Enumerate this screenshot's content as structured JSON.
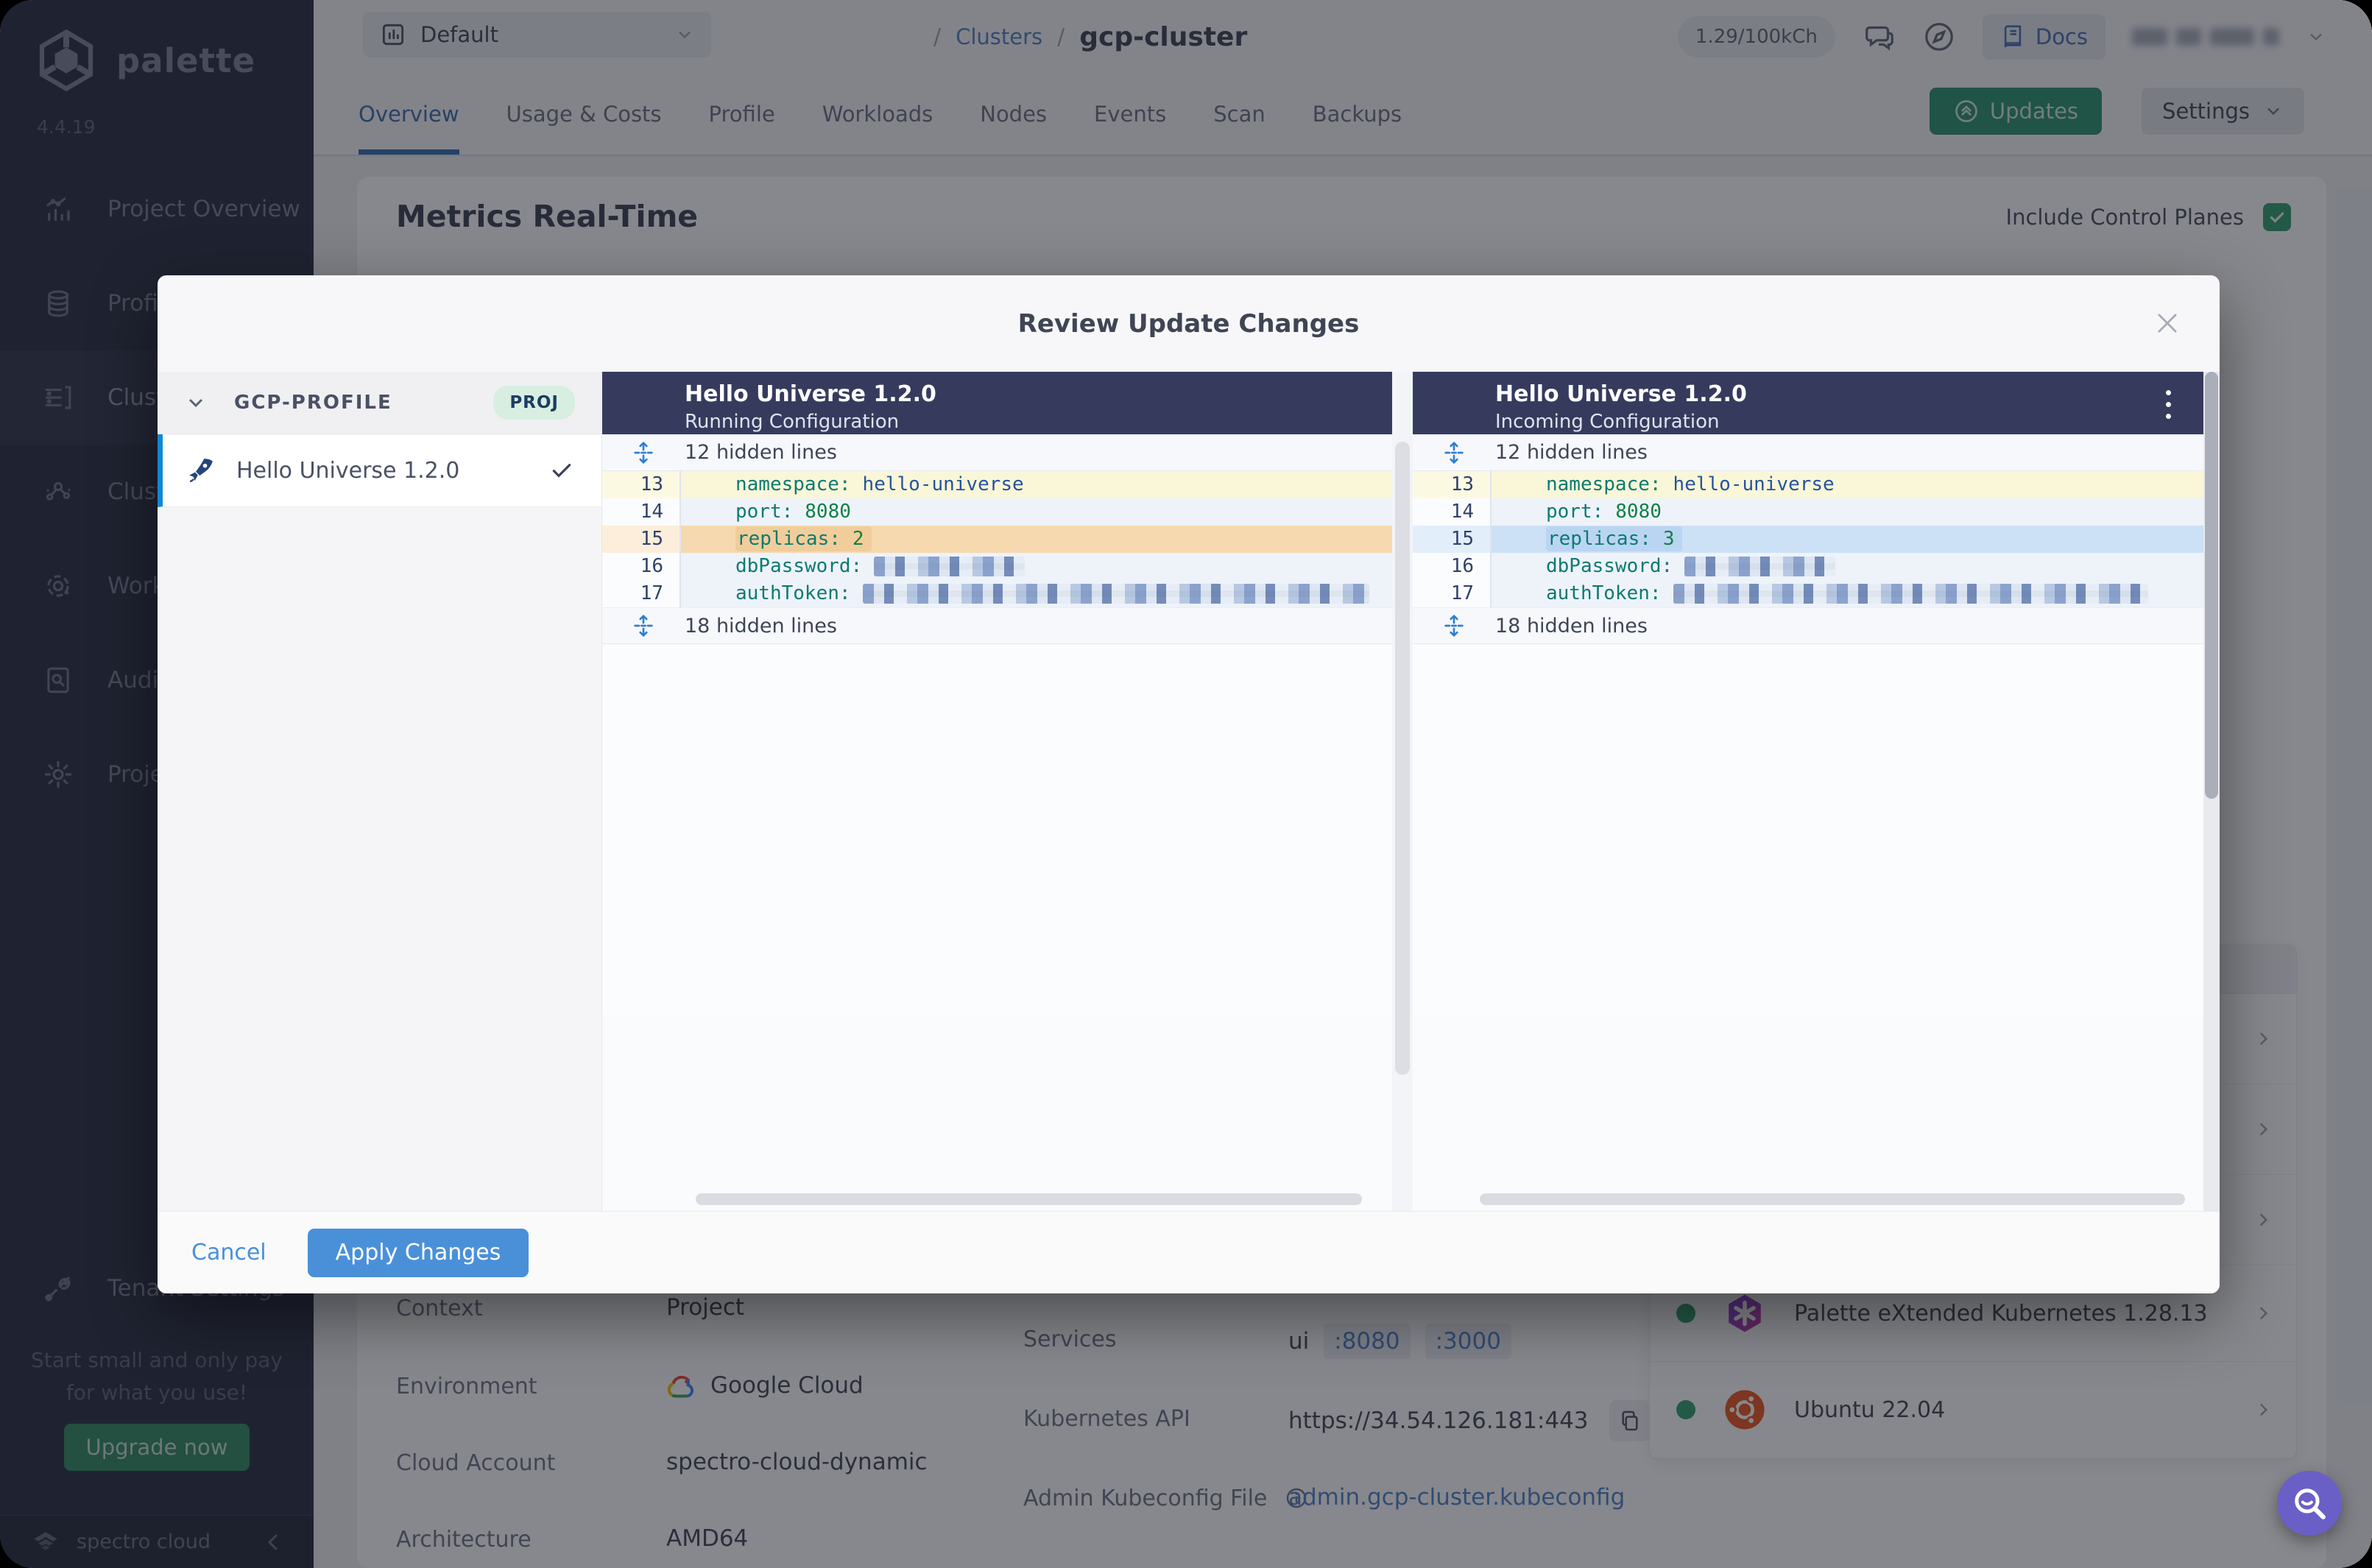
{
  "sidebar": {
    "logo_text": "palette",
    "version": "4.4.19",
    "items": [
      {
        "label": "Project Overview"
      },
      {
        "label": "Profiles"
      },
      {
        "label": "Clusters"
      },
      {
        "label": "Cluster Groups"
      },
      {
        "label": "Workspaces"
      },
      {
        "label": "Audit Logs"
      },
      {
        "label": "Project Settings"
      }
    ],
    "tenant_settings": "Tenant Settings",
    "promo_line1": "Start small and only pay",
    "promo_line2": "for what you use!",
    "upgrade_label": "Upgrade now",
    "brand": "spectro cloud"
  },
  "topbar": {
    "project_selector": "Default",
    "separator": "/",
    "breadcrumb_parent": "Clusters",
    "breadcrumb_current": "gcp-cluster",
    "usage_badge": "1.29/100kCh",
    "docs_label": "Docs"
  },
  "tabs": {
    "items": [
      {
        "label": "Overview"
      },
      {
        "label": "Usage & Costs"
      },
      {
        "label": "Profile"
      },
      {
        "label": "Workloads"
      },
      {
        "label": "Nodes"
      },
      {
        "label": "Events"
      },
      {
        "label": "Scan"
      },
      {
        "label": "Backups"
      }
    ],
    "active_tab": "Overview",
    "updates_label": "Updates",
    "settings_label": "Settings"
  },
  "content": {
    "heading": "Metrics Real-Time",
    "include_control_planes": "Include Control Planes",
    "details_left": [
      {
        "label": "Context",
        "value": "Project"
      },
      {
        "label": "Environment",
        "value": "Google Cloud"
      },
      {
        "label": "Cloud Account",
        "value": "spectro-cloud-dynamic"
      },
      {
        "label": "Architecture",
        "value": "AMD64"
      }
    ],
    "details_mid": {
      "services_label": "Services",
      "services_name": "ui",
      "services_ports": [
        ":8080",
        ":3000"
      ],
      "k8s_api_label": "Kubernetes API",
      "k8s_api_value": "https://34.54.126.181:443",
      "kubeconfig_label": "Admin Kubeconfig File",
      "kubeconfig_value": "admin.gcp-cluster.kubeconfig"
    },
    "packs": [
      {
        "name": "Palette eXtended Kubernetes 1.28.13",
        "status": "healthy"
      },
      {
        "name": "Ubuntu 22.04",
        "status": "healthy"
      }
    ]
  },
  "modal": {
    "title": "Review Update Changes",
    "group_label": "GCP-PROFILE",
    "group_badge": "PROJ",
    "profile_name": "Hello Universe 1.2.0",
    "left_panel": {
      "title": "Hello Universe 1.2.0",
      "subtitle": "Running Configuration",
      "hidden_top": "12 hidden lines",
      "hidden_bottom": "18 hidden lines",
      "lines": [
        {
          "num": "13",
          "key": "namespace:",
          "value": "hello-universe"
        },
        {
          "num": "14",
          "key": "port:",
          "value": "8080"
        },
        {
          "num": "15",
          "key": "replicas:",
          "value": "2"
        },
        {
          "num": "16",
          "key": "dbPassword:",
          "value_redacted": true
        },
        {
          "num": "17",
          "key": "authToken:",
          "value_redacted": true
        }
      ]
    },
    "right_panel": {
      "title": "Hello Universe 1.2.0",
      "subtitle": "Incoming Configuration",
      "hidden_top": "12 hidden lines",
      "hidden_bottom": "18 hidden lines",
      "lines": [
        {
          "num": "13",
          "key": "namespace:",
          "value": "hello-universe"
        },
        {
          "num": "14",
          "key": "port:",
          "value": "8080"
        },
        {
          "num": "15",
          "key": "replicas:",
          "value": "3"
        },
        {
          "num": "16",
          "key": "dbPassword:",
          "value_redacted": true
        },
        {
          "num": "17",
          "key": "authToken:",
          "value_redacted": true
        }
      ]
    },
    "cancel_label": "Cancel",
    "apply_label": "Apply Changes"
  },
  "colors": {
    "accent_blue": "#4a90d9",
    "updates_green": "#27926b",
    "diff_context_yellow": "#faf6d8",
    "diff_removed_orange": "#f6d9ae",
    "diff_added_blue": "#cde1f6",
    "yaml_key": "#0c7a72",
    "yaml_string": "#24549c",
    "yaml_number": "#108044",
    "sidebar_bg": "#262c3f",
    "diff_header_bg": "#363b5e",
    "fab_purple": "#6a5fc7",
    "status_green": "#2f9e6e"
  }
}
